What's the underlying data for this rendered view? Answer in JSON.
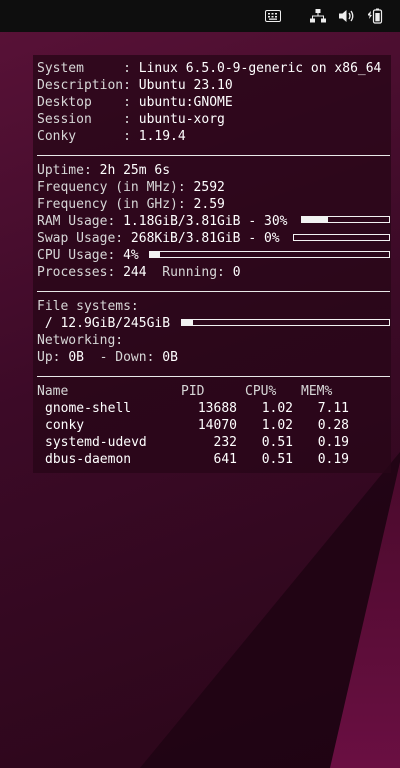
{
  "topbar": {
    "icons": [
      "keyboard-icon",
      "network-icon",
      "volume-icon",
      "battery-icon"
    ]
  },
  "sysinfo": {
    "system_key": "System     :",
    "system_val": "Linux 6.5.0-9-generic on x86_64",
    "description_key": "Description:",
    "description_val": "Ubuntu 23.10",
    "desktop_key": "Desktop    :",
    "desktop_val": "ubuntu:GNOME",
    "session_key": "Session    :",
    "session_val": "ubuntu-xorg",
    "conky_key": "Conky      :",
    "conky_val": "1.19.4"
  },
  "stats": {
    "uptime_key": "Uptime:",
    "uptime_val": "2h 25m 6s",
    "freq_mhz_key": "Frequency (in MHz):",
    "freq_mhz_val": "2592",
    "freq_ghz_key": "Frequency (in GHz):",
    "freq_ghz_val": "2.59",
    "ram_key": "RAM Usage:",
    "ram_val": "1.18GiB/3.81GiB - 30%",
    "ram_fraction": 0.3,
    "swap_key": "Swap Usage:",
    "swap_val": "268KiB/3.81GiB - 0%",
    "swap_fraction": 0.0,
    "cpu_key": "CPU Usage:",
    "cpu_val": "4%",
    "cpu_fraction": 0.04,
    "processes_key": "Processes:",
    "processes_val": "244",
    "running_key": "Running:",
    "running_val": "0"
  },
  "filesystems": {
    "header": "File systems:",
    "root_val": " / 12.9GiB/245GiB",
    "root_fraction": 0.053,
    "networking": "Networking:",
    "up_key": "Up:",
    "up_val": "0B",
    "down_key": "- Down:",
    "down_val": "0B"
  },
  "processes": {
    "headers": [
      "Name",
      "PID",
      "CPU%",
      "MEM%"
    ],
    "rows": [
      {
        "name": "gnome-shell",
        "pid": "13688",
        "cpu": "1.02",
        "mem": "7.11"
      },
      {
        "name": "conky",
        "pid": "14070",
        "cpu": "1.02",
        "mem": "0.28"
      },
      {
        "name": "systemd-udevd",
        "pid": "232",
        "cpu": "0.51",
        "mem": "0.19"
      },
      {
        "name": "dbus-daemon",
        "pid": "641",
        "cpu": "0.51",
        "mem": "0.19"
      }
    ]
  }
}
